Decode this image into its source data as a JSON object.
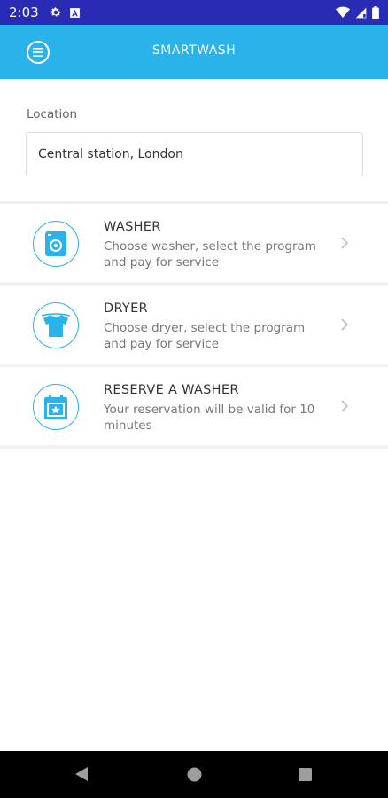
{
  "status_bar": {
    "time": "2:03",
    "icons": [
      "settings-gear-icon",
      "notification-a-icon",
      "wifi-icon",
      "signal-icon",
      "battery-icon"
    ]
  },
  "app_bar": {
    "title": "SMARTWASH",
    "menu_icon": "hamburger-menu-icon"
  },
  "location": {
    "label": "Location",
    "value": "Central station, London"
  },
  "menu": {
    "items": [
      {
        "icon": "washing-machine-icon",
        "title": "WASHER",
        "description": "Choose washer, select the program and pay for service"
      },
      {
        "icon": "tshirt-icon",
        "title": "DRYER",
        "description": "Choose dryer, select the program and pay for service"
      },
      {
        "icon": "calendar-star-icon",
        "title": "RESERVE A WASHER",
        "description": "Your reservation will be valid for 10 minutes"
      }
    ]
  },
  "nav_bar": {
    "icons": [
      "back-icon",
      "home-icon",
      "recents-icon"
    ]
  },
  "colors": {
    "status_bar": "#2a2bb5",
    "primary": "#2ab2ea",
    "nav_bar": "#000000"
  }
}
